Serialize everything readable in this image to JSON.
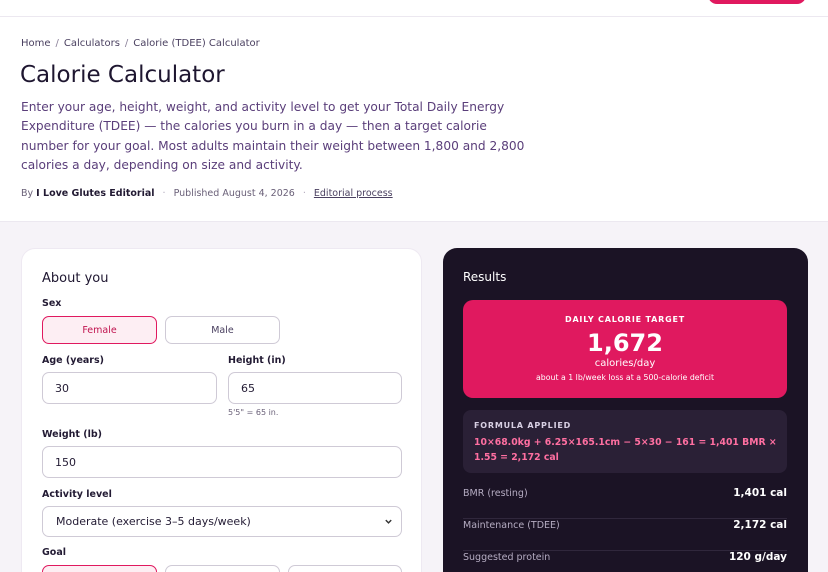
{
  "breadcrumb": {
    "home": "Home",
    "calculators": "Calculators",
    "current": "Calorie (TDEE) Calculator",
    "separator": "/"
  },
  "page": {
    "title": "Calorie Calculator",
    "intro": "Enter your age, height, weight, and activity level to get your Total Daily Energy Expenditure (TDEE) — the calories you burn in a day — then a target calorie number for your goal. Most adults maintain their weight between 1,800 and 2,800 calories a day, depending on size and activity."
  },
  "byline": {
    "prefix": "By",
    "author": "I Love Glutes Editorial",
    "published": "Published August 4, 2026",
    "process_link": "Editorial process",
    "dot": "·"
  },
  "form": {
    "heading": "About you",
    "sex_label": "Sex",
    "sex_options": [
      "Female",
      "Male"
    ],
    "sex_selected": "Female",
    "age_label": "Age (years)",
    "age_value": "30",
    "height_label": "Height (in)",
    "height_value": "65",
    "height_hint": "5'5\" = 65 in.",
    "weight_label": "Weight (lb)",
    "weight_value": "150",
    "activity_label": "Activity level",
    "activity_value": "Moderate (exercise 3–5 days/week)",
    "goal_label": "Goal"
  },
  "results": {
    "heading": "Results",
    "target_label": "DAILY CALORIE TARGET",
    "target_value": "1,672",
    "target_unit": "calories/day",
    "target_note": "about a 1 lb/week loss at a 500-calorie deficit",
    "formula_label": "FORMULA APPLIED",
    "formula_text": "10×68.0kg + 6.25×165.1cm − 5×30 − 161 = 1,401 BMR × 1.55 = 2,172 cal",
    "rows": [
      {
        "label": "BMR (resting)",
        "value": "1,401 cal"
      },
      {
        "label": "Maintenance (TDEE)",
        "value": "2,172 cal"
      },
      {
        "label": "Suggested protein",
        "value": "120 g/day"
      }
    ]
  },
  "colors": {
    "accent": "#e0195f",
    "dark_panel": "#1b1325",
    "formula_text": "#ff6fa1"
  },
  "icons": {
    "select_arrow": "chevron-down-icon"
  }
}
